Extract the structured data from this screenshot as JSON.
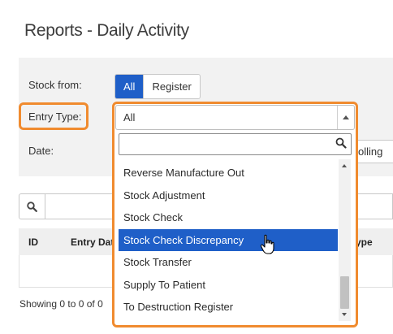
{
  "page": {
    "title": "Reports - Daily Activity"
  },
  "filters": {
    "stock_from_label": "Stock from:",
    "stock_from_options": [
      "All",
      "Register"
    ],
    "stock_from_selected": "All",
    "entry_type_label": "Entry Type:",
    "entry_type_value": "All",
    "date_label": "Date:",
    "date_rolling_label": "olling"
  },
  "dropdown": {
    "search_value": "",
    "items": [
      "Reverse Manufacture Out",
      "Stock Adjustment",
      "Stock Check",
      "Stock Check Discrepancy",
      "Stock Transfer",
      "Supply To Patient",
      "To Destruction Register"
    ],
    "highlighted": "Stock Check Discrepancy"
  },
  "grid": {
    "columns": [
      "ID",
      "Entry Date",
      "ype"
    ],
    "footer": "Showing 0 to 0 of 0"
  },
  "colors": {
    "accent_blue": "#1f5fc8",
    "highlight_orange": "#f08b2f"
  }
}
